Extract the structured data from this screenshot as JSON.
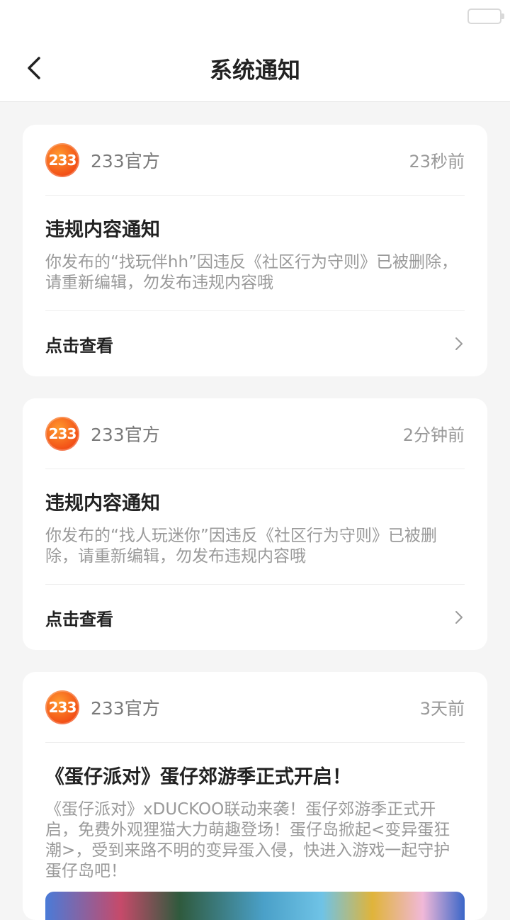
{
  "header": {
    "title": "系统通知"
  },
  "notifications": [
    {
      "avatar_text": "233",
      "author": "233官方",
      "time": "23秒前",
      "title": "违规内容通知",
      "text": "你发布的“找玩伴hh”因违反《社区行为守则》已被删除，请重新编辑，勿发布违规内容哦",
      "action": "点击查看"
    },
    {
      "avatar_text": "233",
      "author": "233官方",
      "time": "2分钟前",
      "title": "违规内容通知",
      "text": "你发布的“找人玩迷你”因违反《社区行为守则》已被删除，请重新编辑，勿发布违规内容哦",
      "action": "点击查看"
    },
    {
      "avatar_text": "233",
      "author": "233官方",
      "time": "3天前",
      "title": "《蛋仔派对》蛋仔郊游季正式开启！",
      "text": "《蛋仔派对》xDUCKOO联动来袭！蛋仔郊游季正式开启，免费外观狸猫大力萌趣登场！蛋仔岛掀起<变异蛋狂潮>，受到来路不明的变异蛋入侵，快进入游戏一起守护蛋仔岛吧！"
    }
  ],
  "colors": {
    "accent": "#f24e16",
    "background": "#f5f5f5",
    "card": "#ffffff"
  },
  "icons": {
    "back": "chevron-left-icon",
    "more": "chevron-right-icon",
    "battery": "battery-icon"
  }
}
